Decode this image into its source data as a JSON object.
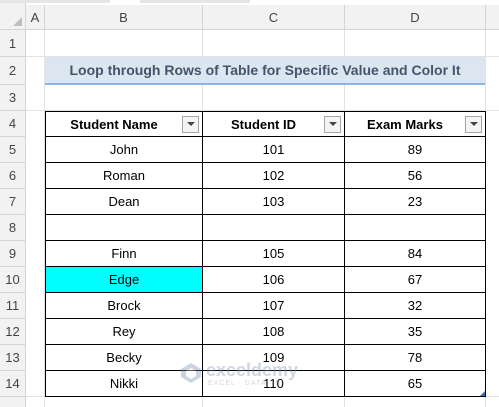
{
  "sheet": {
    "columns": [
      "A",
      "B",
      "C",
      "D"
    ],
    "rows": [
      "1",
      "2",
      "3",
      "4",
      "5",
      "6",
      "7",
      "8",
      "9",
      "10",
      "11",
      "12",
      "13",
      "14"
    ]
  },
  "title": "Loop through Rows of Table for Specific Value and Color It",
  "table": {
    "headers": [
      "Student Name",
      "Student ID",
      "Exam Marks"
    ],
    "rows": [
      [
        "John",
        "101",
        "89"
      ],
      [
        "Roman",
        "102",
        "56"
      ],
      [
        "Dean",
        "103",
        "23"
      ],
      [
        "",
        "",
        ""
      ],
      [
        "Finn",
        "105",
        "84"
      ],
      [
        "Edge",
        "106",
        "67"
      ],
      [
        "Brock",
        "107",
        "32"
      ],
      [
        "Rey",
        "108",
        "35"
      ],
      [
        "Becky",
        "109",
        "78"
      ],
      [
        "Nikki",
        "110",
        "65"
      ]
    ],
    "highlight_color": "#00ffff"
  },
  "watermark": {
    "name": "exceldemy",
    "tagline": "EXCEL · DATA · BI",
    "icon": "exceldemy-logo-icon"
  }
}
